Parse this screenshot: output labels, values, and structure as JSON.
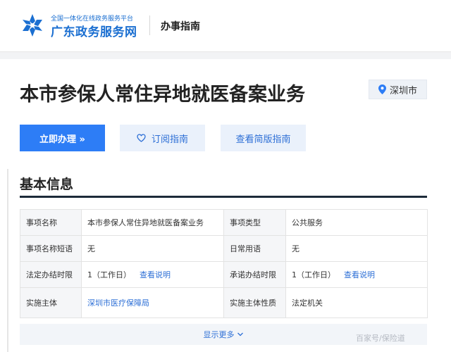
{
  "brand": {
    "subtitle": "全国一体化在线政务服务平台",
    "name": "广东政务服务网",
    "color": "#1b6fd1"
  },
  "nav": {
    "label": "办事指南"
  },
  "page": {
    "title": "本市参保人常住异地就医备案业务"
  },
  "location": {
    "icon": "location-pin-icon",
    "city": "深圳市"
  },
  "actions": {
    "primary": "立即办理 »",
    "subscribe": "订阅指南",
    "subscribe_icon": "heart-icon",
    "brief": "查看简版指南",
    "accent_color": "#2d7df6"
  },
  "basic_info": {
    "title": "基本信息",
    "rows": [
      {
        "l1": "事项名称",
        "v1": "本市参保人常住异地就医备案业务",
        "l2": "事项类型",
        "v2": "公共服务"
      },
      {
        "l1": "事项名称短语",
        "v1": "无",
        "l2": "日常用语",
        "v2": "无"
      },
      {
        "l1": "法定办结时限",
        "v1": "1（工作日）",
        "v1_link": "查看说明",
        "l2": "承诺办结时限",
        "v2": "1（工作日）",
        "v2_link": "查看说明"
      },
      {
        "l1": "实施主体",
        "v1": "深圳市医疗保障局",
        "l2": "实施主体性质",
        "v2": "法定机关"
      }
    ],
    "more": "显示更多"
  },
  "watermark": "百家号/保险道"
}
